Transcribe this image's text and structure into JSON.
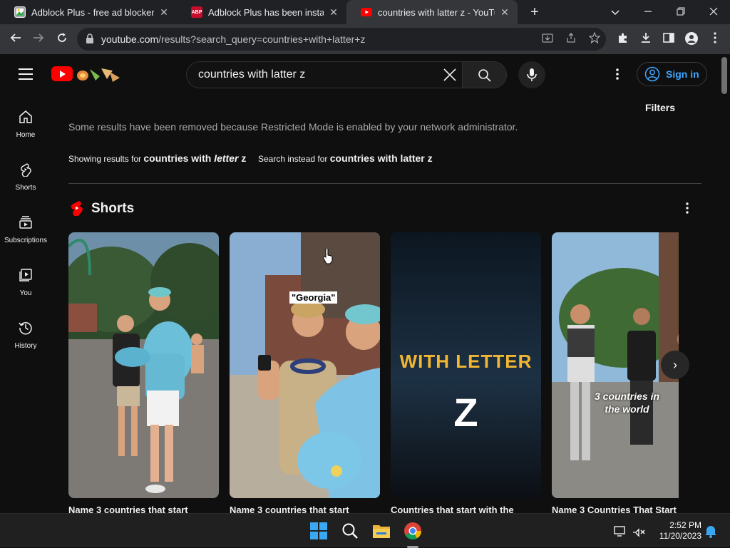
{
  "browser": {
    "tabs": [
      {
        "title": "Adblock Plus - free ad blocker",
        "favicon": "gallery-icon",
        "active": false
      },
      {
        "title": "Adblock Plus has been installed!",
        "favicon": "abp-icon",
        "favicon_text": "ABP",
        "active": false
      },
      {
        "title": "countries with latter z - YouTube",
        "favicon": "youtube-icon",
        "active": true
      }
    ],
    "url_host": "youtube.com",
    "url_path": "/results?search_query=countries+with+latter+z"
  },
  "youtube": {
    "search_query": "countries with latter z",
    "sign_in_label": "Sign in",
    "filters_label": "Filters",
    "sidebar": [
      {
        "label": "Home",
        "icon": "home-icon"
      },
      {
        "label": "Shorts",
        "icon": "shorts-icon"
      },
      {
        "label": "Subscriptions",
        "icon": "subscriptions-icon"
      },
      {
        "label": "You",
        "icon": "you-icon"
      },
      {
        "label": "History",
        "icon": "history-icon"
      }
    ],
    "restricted_notice": "Some results have been removed because Restricted Mode is enabled by your network administrator.",
    "correction": {
      "showing_prefix": "Showing results for",
      "showing_a": "countries with",
      "showing_b": "letter",
      "showing_c": "z",
      "instead_prefix": "Search instead for",
      "instead_query": "countries with latter z"
    },
    "shorts_heading": "Shorts",
    "shorts": [
      {
        "title": "Name 3 countries that start",
        "overlay": ""
      },
      {
        "title": "Name 3 countries that start",
        "overlay": "\"Georgia\""
      },
      {
        "title": "Countries that start with the",
        "overlay": "WITH LETTER",
        "overlay2": "Z"
      },
      {
        "title": "Name 3 Countries That Start",
        "overlay": "3 countries in",
        "overlay2": "the world"
      }
    ]
  },
  "taskbar": {
    "time": "2:52 PM",
    "date": "11/20/2023"
  },
  "colors": {
    "brand_red": "#ff0000",
    "link_blue": "#3ea6ff",
    "accent_yellow": "#f2b632"
  }
}
